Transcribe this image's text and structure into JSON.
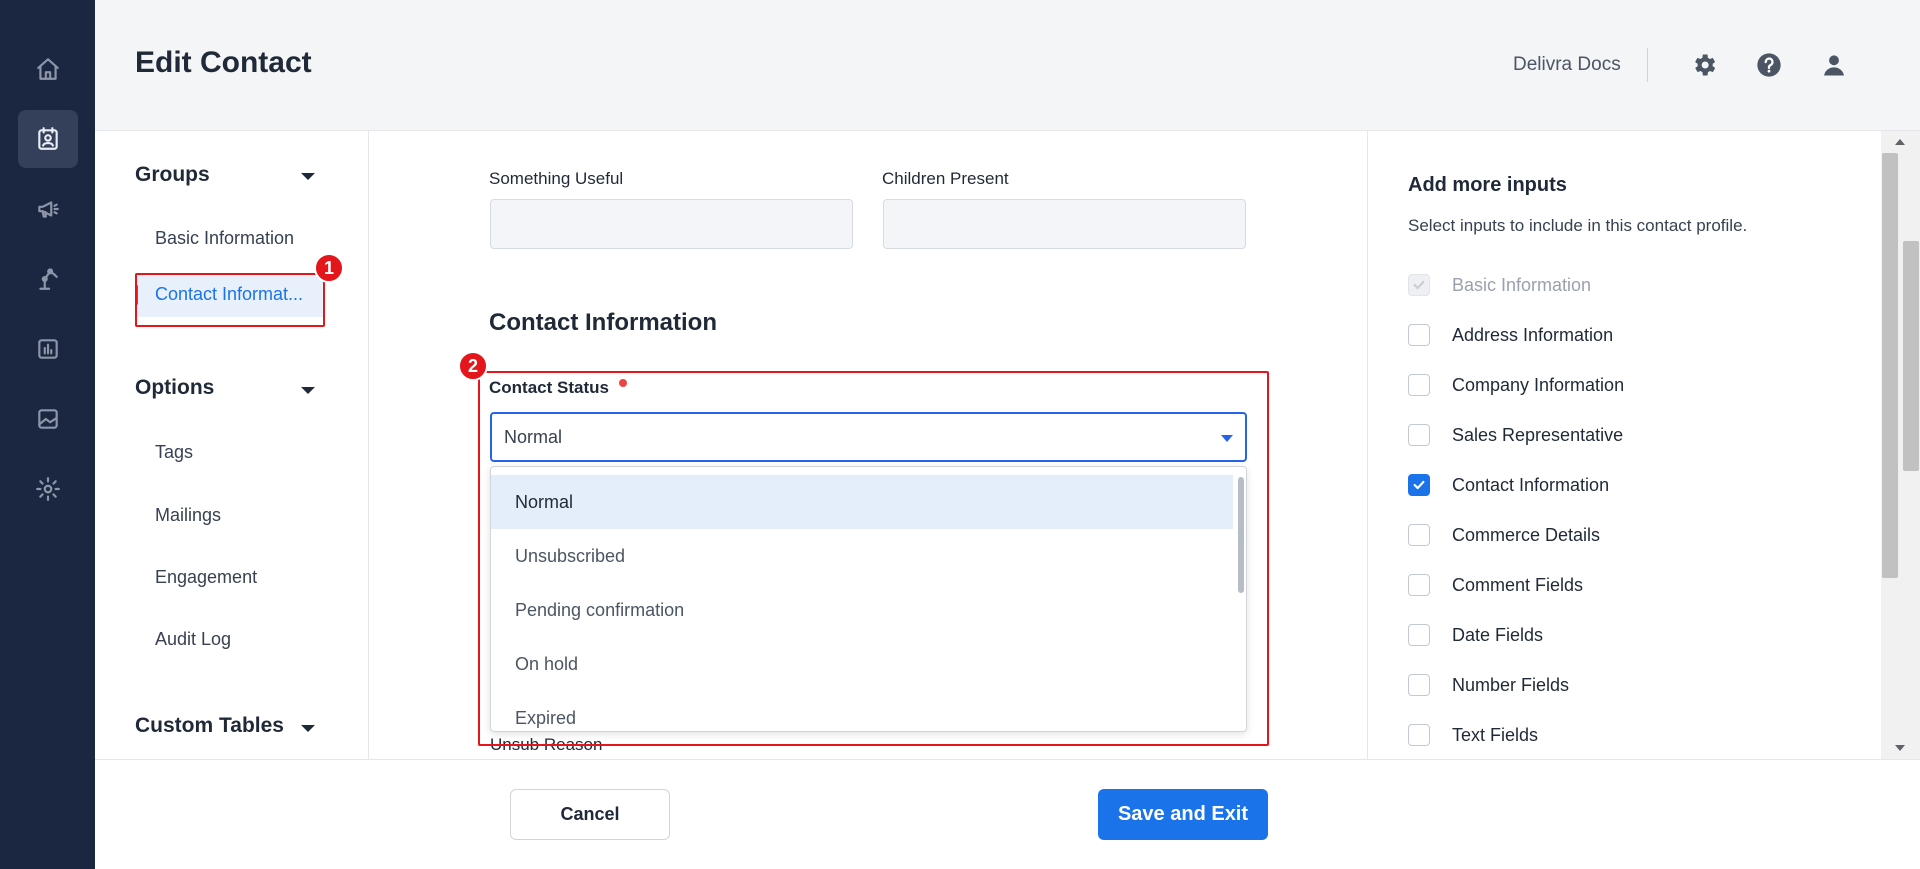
{
  "header": {
    "title": "Edit Contact",
    "docs_link": "Delivra Docs",
    "icons": [
      "gear-icon",
      "help-icon",
      "user-icon"
    ]
  },
  "nav_rail": {
    "icons": [
      "home-icon",
      "contacts-icon",
      "megaphone-icon",
      "automation-icon",
      "reports-icon",
      "image-icon",
      "settings-icon"
    ],
    "active": "contacts-icon"
  },
  "groups_panel": {
    "sections": [
      {
        "title": "Groups",
        "items": [
          "Basic Information",
          "Contact Informat..."
        ]
      },
      {
        "title": "Options",
        "items": [
          "Tags",
          "Mailings",
          "Engagement",
          "Audit Log"
        ]
      },
      {
        "title": "Custom Tables",
        "items": []
      }
    ],
    "active_item": "Contact Informat..."
  },
  "form": {
    "fields_top": [
      {
        "label": "Something Useful",
        "value": ""
      },
      {
        "label": "Children Present",
        "value": ""
      }
    ],
    "section_title": "Contact Information",
    "contact_status": {
      "label": "Contact Status",
      "value": "Normal",
      "options": [
        "Normal",
        "Unsubscribed",
        "Pending confirmation",
        "On hold",
        "Expired"
      ]
    },
    "unsub_reason_label": "Unsub Reason"
  },
  "right_panel": {
    "title": "Add more inputs",
    "subtitle": "Select inputs to include in this contact profile.",
    "inputs": [
      {
        "label": "Basic Information",
        "checked": true,
        "disabled": true
      },
      {
        "label": "Address Information",
        "checked": false,
        "disabled": false
      },
      {
        "label": "Company Information",
        "checked": false,
        "disabled": false
      },
      {
        "label": "Sales Representative",
        "checked": false,
        "disabled": false
      },
      {
        "label": "Contact Information",
        "checked": true,
        "disabled": false
      },
      {
        "label": "Commerce Details",
        "checked": false,
        "disabled": false
      },
      {
        "label": "Comment Fields",
        "checked": false,
        "disabled": false
      },
      {
        "label": "Date Fields",
        "checked": false,
        "disabled": false
      },
      {
        "label": "Number Fields",
        "checked": false,
        "disabled": false
      },
      {
        "label": "Text Fields",
        "checked": false,
        "disabled": false
      }
    ]
  },
  "footer": {
    "cancel_label": "Cancel",
    "save_label": "Save and Exit"
  },
  "annotations": [
    "1",
    "2"
  ],
  "colors": {
    "nav_bg": "#1b2640",
    "accent": "#1a73e8",
    "annotation_red": "#e3161c"
  }
}
